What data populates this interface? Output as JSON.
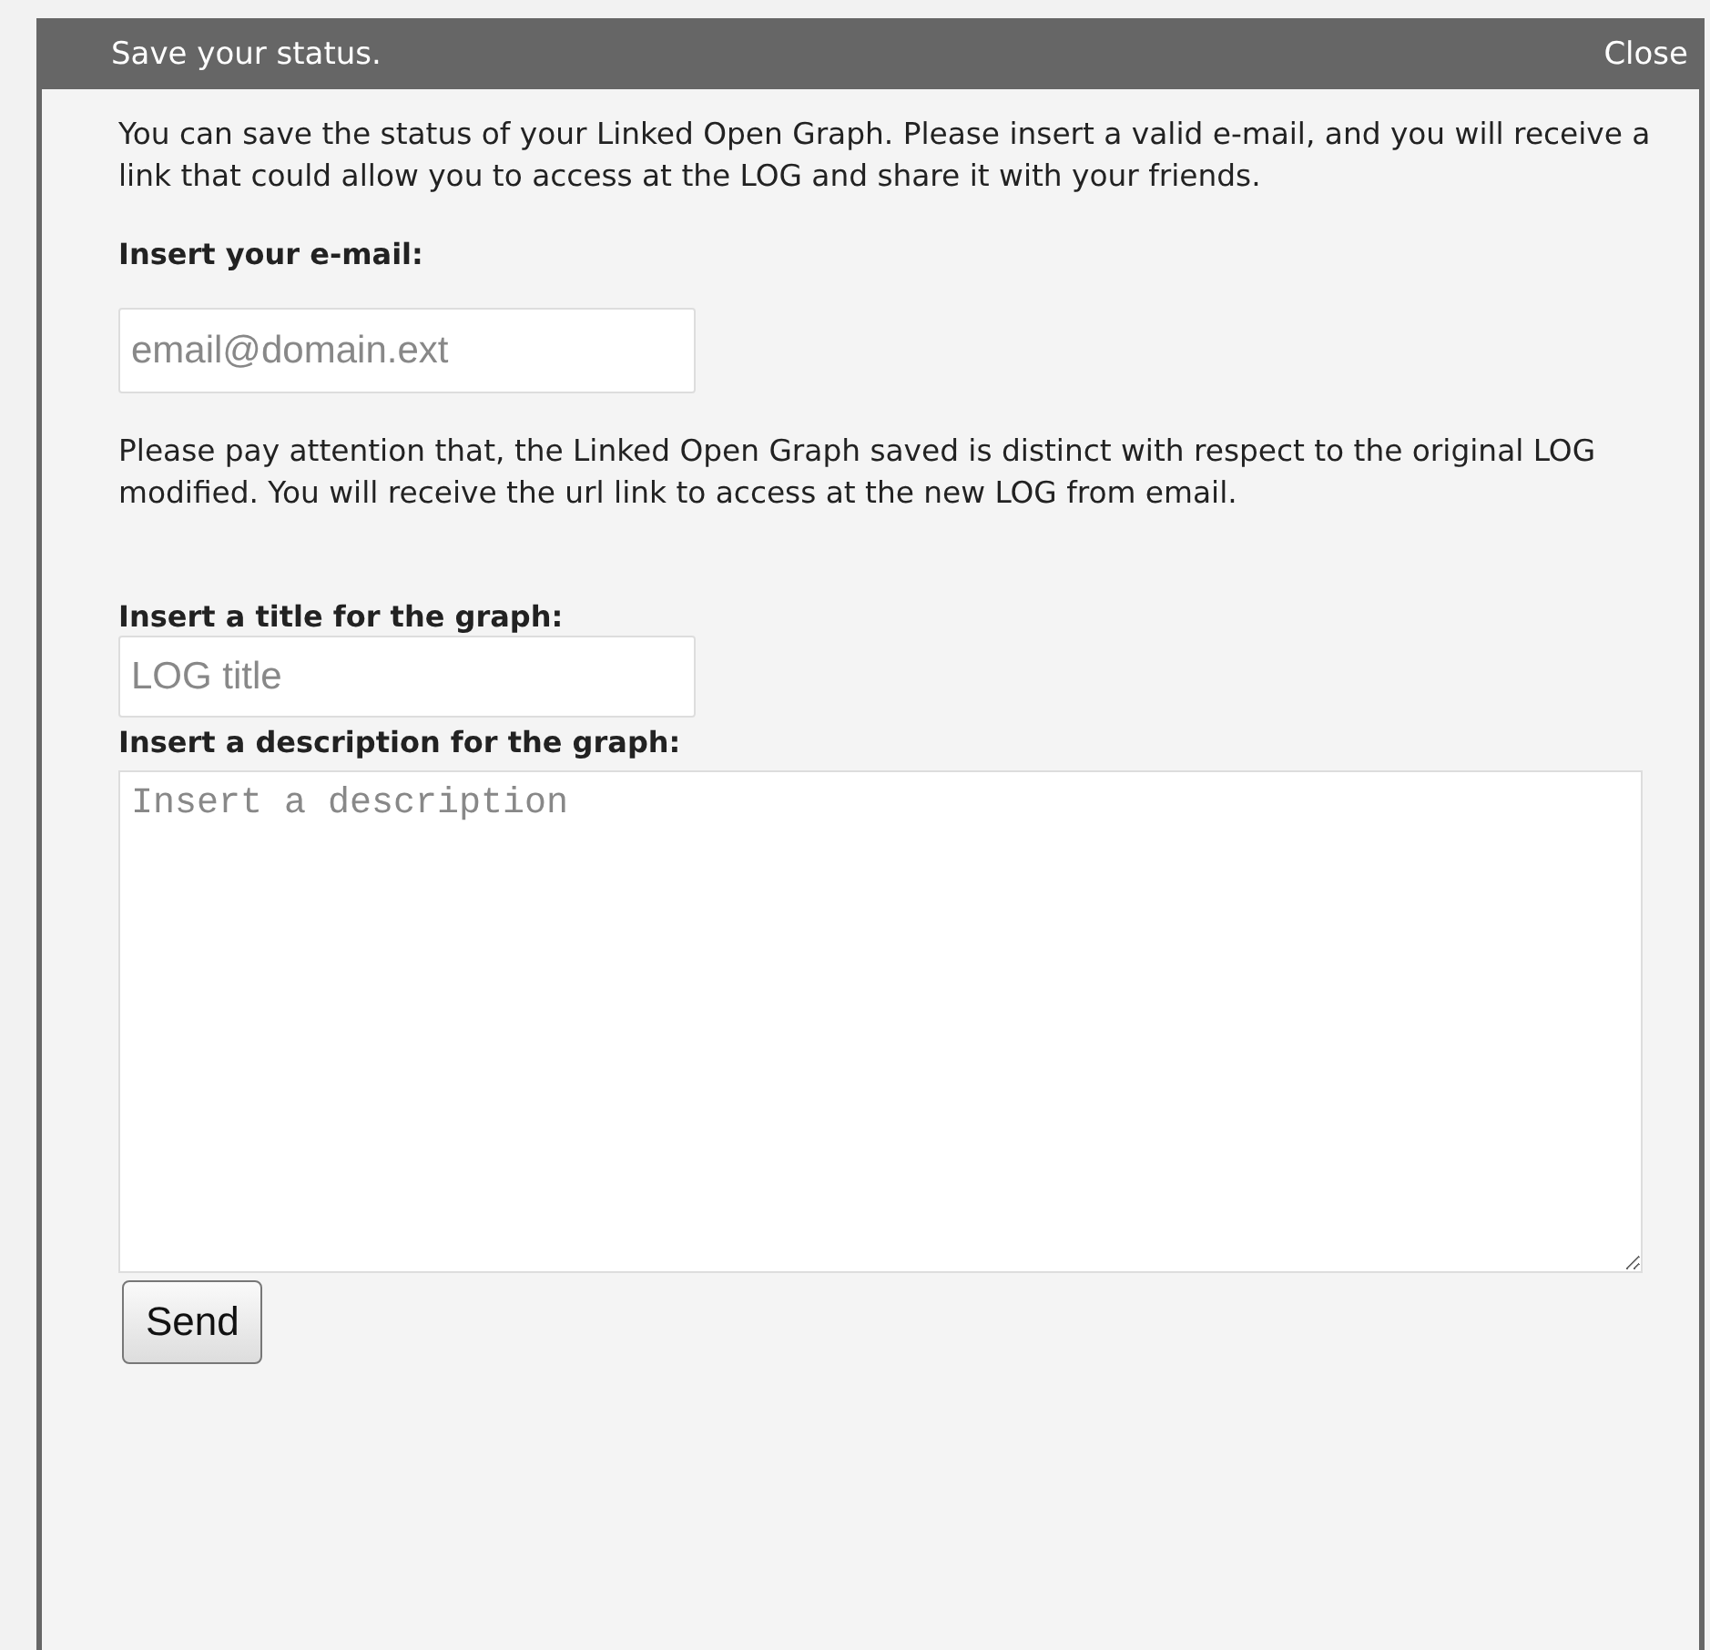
{
  "dialog": {
    "title": "Save your status.",
    "close": "Close"
  },
  "intro": "You can save the status of your Linked Open Graph. Please insert a valid e-mail, and you will receive a link that could allow you to access at the LOG and share it with your friends.",
  "email_label": "Insert your e-mail:",
  "email_field": {
    "placeholder": "email@domain.ext"
  },
  "notice": "Please pay attention that, the Linked Open Graph saved is distinct with respect to the original LOG modified. You will receive the url link to access at the new LOG from email.",
  "title_label": "Insert a title for the graph:",
  "title_field": {
    "placeholder": "LOG title"
  },
  "description_label": "Insert a description for the graph:",
  "description_field": {
    "placeholder": "Insert a description"
  },
  "send_button": "Send"
}
